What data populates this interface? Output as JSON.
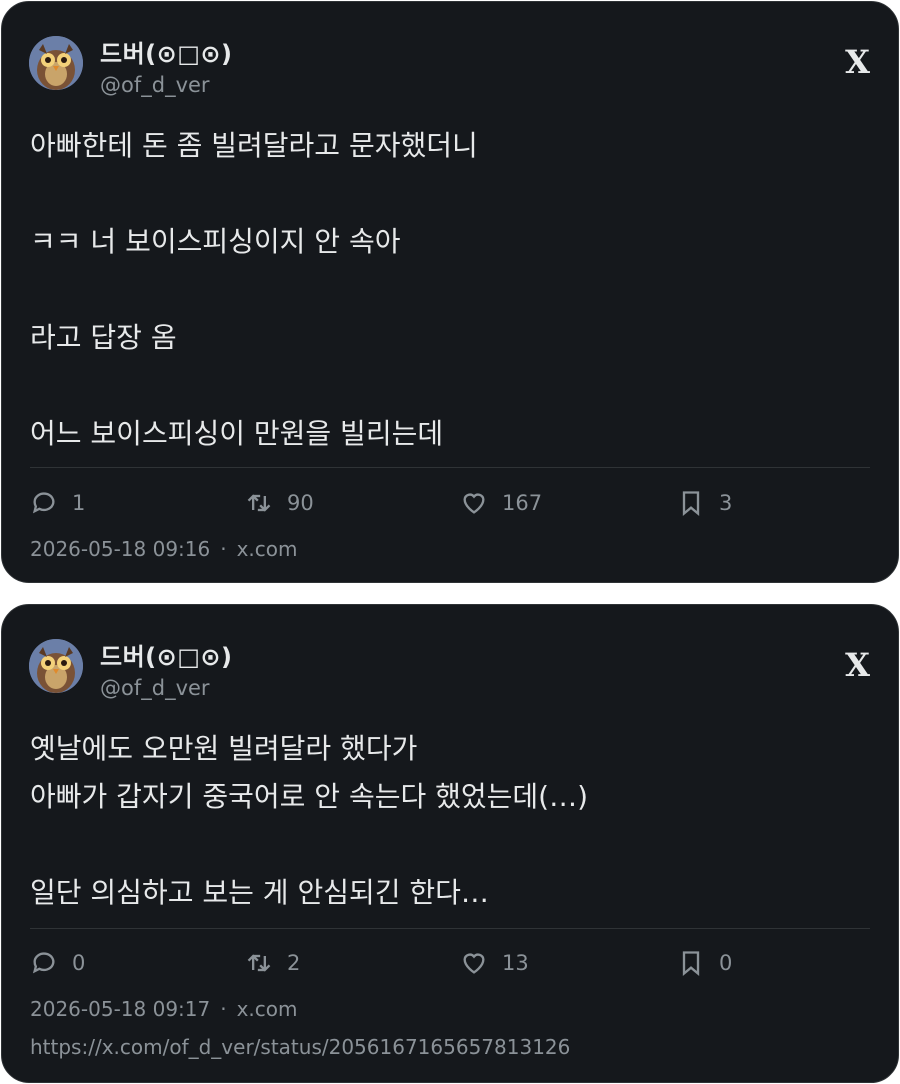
{
  "posts": [
    {
      "author": {
        "name": "드버(⊙□⊙)",
        "handle": "@of_d_ver"
      },
      "logo": "X",
      "paragraphs": [
        "아빠한테 돈 좀 빌려달라고 문자했더니",
        "ㅋㅋ 너 보이스피싱이지 안 속아",
        "라고 답장 옴",
        "어느 보이스피싱이 만원을 빌리는데"
      ],
      "stats": {
        "replies": "1",
        "reposts": "90",
        "likes": "167",
        "bookmarks": "3"
      },
      "timestamp": "2026-05-18 09:16",
      "source": "x.com"
    },
    {
      "author": {
        "name": "드버(⊙□⊙)",
        "handle": "@of_d_ver"
      },
      "logo": "X",
      "lines": [
        "옛날에도 오만원 빌려달라 했다가",
        "아빠가 갑자기 중국어로 안 속는다 했었는데(…)",
        "일단 의심하고 보는 게 안심되긴 한다…"
      ],
      "stats": {
        "replies": "0",
        "reposts": "2",
        "likes": "13",
        "bookmarks": "0"
      },
      "timestamp": "2026-05-18 09:17",
      "source": "x.com",
      "link": "https://x.com/of_d_ver/status/2056167165657813126"
    }
  ],
  "icons": {
    "reply": "speech-bubble-icon",
    "repost": "repost-icon",
    "like": "heart-icon",
    "bookmark": "bookmark-icon"
  },
  "colors": {
    "card_bg": "#15181c",
    "text": "#e7e9ea",
    "muted": "#8b9298",
    "border": "#2f3336"
  }
}
